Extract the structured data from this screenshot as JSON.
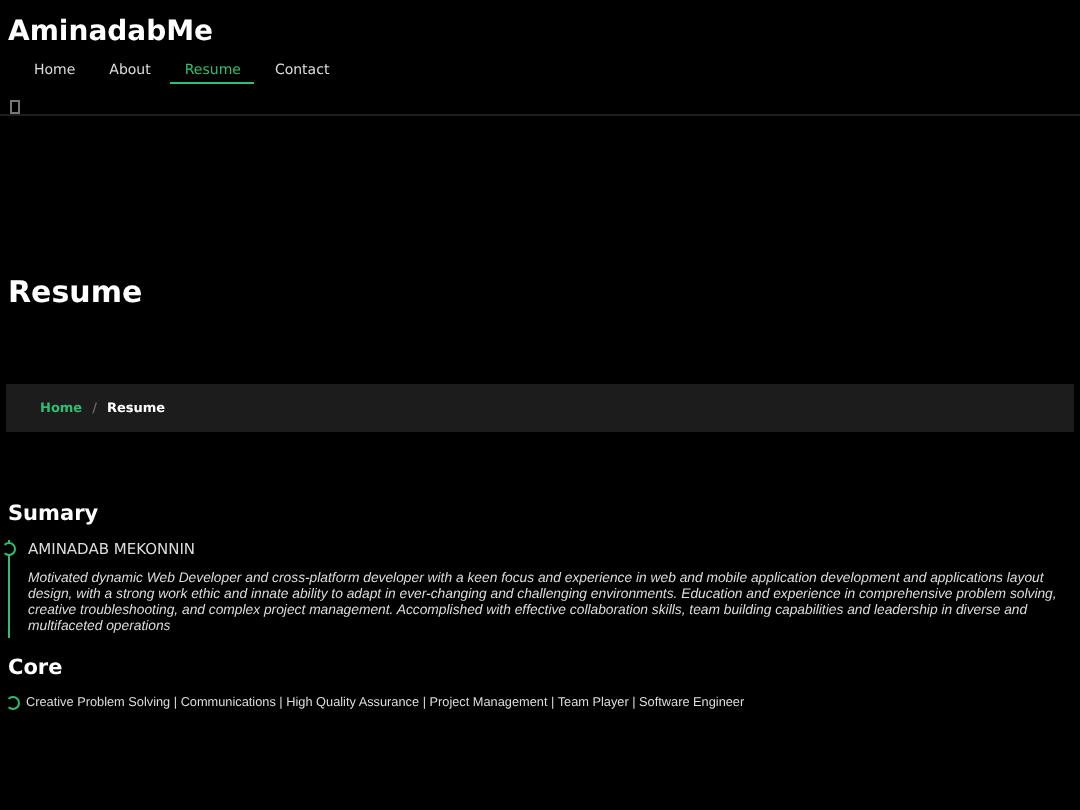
{
  "brand": "AminadabMe",
  "nav": [
    {
      "label": "Home",
      "selected": false
    },
    {
      "label": "About",
      "selected": false
    },
    {
      "label": "Resume",
      "selected": true
    },
    {
      "label": "Contact",
      "selected": false
    }
  ],
  "page_title": "Resume",
  "breadcrumb_separator": "/",
  "breadcrumb": [
    {
      "label": "Home",
      "kind": "link"
    },
    {
      "label": "Resume",
      "kind": "current"
    }
  ],
  "sections": [
    {
      "title": "Sumary",
      "items": [
        {
          "kind": "entry",
          "heading": "AMINADAB MEKONNIN",
          "text": "Motivated dynamic Web Developer and cross-platform developer with a keen focus and experience in web and mobile application development and applications layout design, with a strong work ethic and innate ability to adapt in ever-changing and challenging environments. Education and experience in comprehensive problem solving, creative troubleshooting, and complex project management. Accomplished with effective collaboration skills, team building capabilities and leadership in diverse and multifaceted operations"
        }
      ]
    },
    {
      "title": "Core",
      "items": [
        {
          "kind": "line",
          "text": "Creative Problem Solving | Communications | High Quality Assurance | Project Management | Team Player | Software Engineer"
        }
      ]
    }
  ]
}
